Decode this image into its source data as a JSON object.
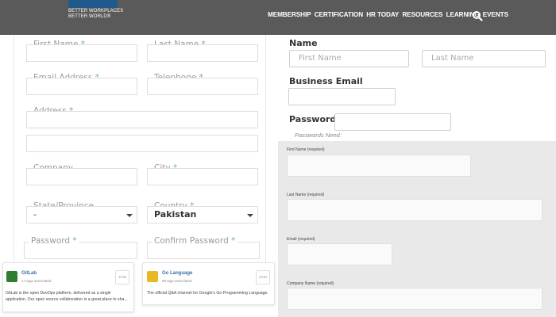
{
  "header": {
    "logo_lines": [
      "BETTER WORKPLACES",
      "BETTER WORLD®"
    ],
    "nav": [
      "MEMBERSHIP",
      "CERTIFICATION",
      "HR TODAY",
      "RESOURCES",
      "LEARNING",
      "EVENTS"
    ],
    "bg_color": "#5a5a5a"
  },
  "left_form": {
    "first_name": "First Name",
    "last_name": "Last Name",
    "email": "Email Address",
    "telephone": "Telephone",
    "address": "Address",
    "company": "Company",
    "city": "City",
    "state": "State/Province",
    "state_value": "-",
    "country": "Country",
    "country_value": "Pakistan",
    "password": "Password",
    "confirm_password": "Confirm Password",
    "required_marker": "*"
  },
  "right_form": {
    "name_label": "Name",
    "first_placeholder": "First Name",
    "last_placeholder": "Last Name",
    "business_email_label": "Business Email",
    "password_label": "Password",
    "password_hint": "Passwords Need:"
  },
  "grey_form": {
    "first_name": "First Name (required)",
    "last_name": "Last Name (required)",
    "email": "Email (required)",
    "company": "Company Name (required)"
  },
  "cards": [
    {
      "title": "GitLab",
      "sub": "17 tags associated",
      "badge": "JOIN",
      "desc1": "GitLab is the open DevOps platform, delivered as a single",
      "desc2": "application. Our open source collaboration is a great place to sha...",
      "logo_color": "#2e7d32"
    },
    {
      "title": "Go Language",
      "sub": "65 tags associated",
      "badge": "JOIN",
      "desc1": "The official Q&A channel for Google's Go Programming Language.",
      "desc2": "",
      "logo_color": "#e8b923"
    }
  ]
}
